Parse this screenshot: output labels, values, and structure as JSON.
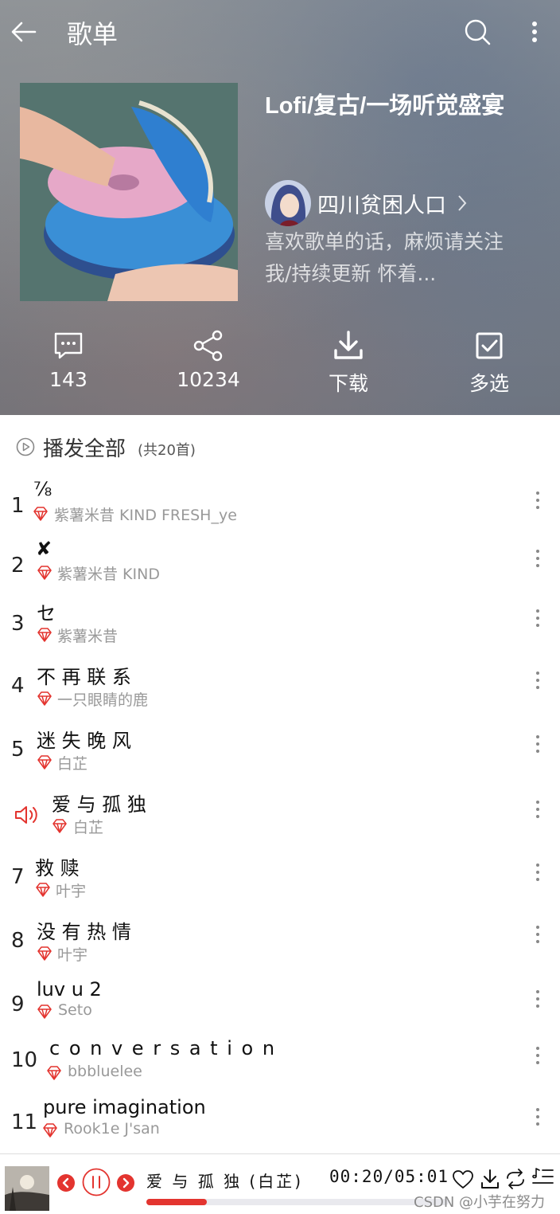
{
  "header": {
    "title": "歌单"
  },
  "playlist": {
    "title": "Lofi/复古/一场听觉盛宴",
    "creator": "四川贫困人口",
    "description": "喜欢歌单的话，麻烦请关注我/持续更新 怀着..."
  },
  "actions": [
    {
      "label": "143",
      "icon": "comment-icon"
    },
    {
      "label": "10234",
      "icon": "share-icon"
    },
    {
      "label": "下载",
      "icon": "download-icon"
    },
    {
      "label": "多选",
      "icon": "checkbox-icon"
    }
  ],
  "play_all": {
    "label": "播发全部",
    "count": "(共20首)"
  },
  "songs": [
    {
      "index": "1",
      "title": "⅞",
      "artist": "紫薯米昔 KIND FRESH_ye"
    },
    {
      "index": "2",
      "title": "✘",
      "artist": "紫薯米昔 KIND"
    },
    {
      "index": "3",
      "title": "セ",
      "artist": "紫薯米昔"
    },
    {
      "index": "4",
      "title": "不 再 联 系",
      "artist": "一只眼睛的鹿"
    },
    {
      "index": "5",
      "title": "迷 失 晚 风",
      "artist": "白芷"
    },
    {
      "index": "",
      "title": "爱 与 孤 独",
      "artist": "白芷",
      "playing": true
    },
    {
      "index": "7",
      "title": "救 赎",
      "artist": "叶宇"
    },
    {
      "index": "8",
      "title": "没 有 热 情",
      "artist": "叶宇"
    },
    {
      "index": "9",
      "title": "luv u 2",
      "artist": "Seto"
    },
    {
      "index": "10",
      "title": "c o n v e r s a t i o n",
      "artist": "bbbluelee"
    },
    {
      "index": "11",
      "title": "pure imagination",
      "artist": "Rook1e J'san"
    }
  ],
  "player": {
    "now_playing": "爱 与 孤 独  (白芷)",
    "time": "00:20/05:01",
    "progress": 0.2,
    "watermark": "CSDN @小芋在努力"
  },
  "colors": {
    "accent": "#e3342f",
    "vip": "#e3342f"
  }
}
